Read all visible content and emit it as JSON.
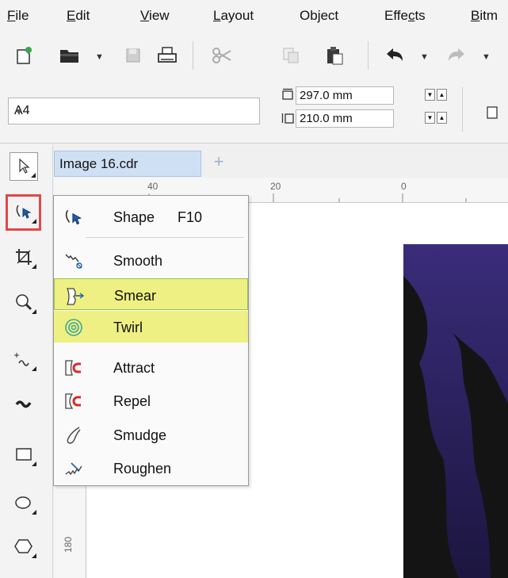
{
  "menubar": {
    "items": [
      {
        "pre": "",
        "u": "F",
        "post": "ile"
      },
      {
        "pre": "",
        "u": "E",
        "post": "dit"
      },
      {
        "pre": "",
        "u": "V",
        "post": "iew"
      },
      {
        "pre": "",
        "u": "L",
        "post": "ayout"
      },
      {
        "pre": "Ob",
        "u": "j",
        "post": "ect"
      },
      {
        "pre": "Effe",
        "u": "c",
        "post": "ts"
      },
      {
        "pre": "",
        "u": "B",
        "post": "itm"
      }
    ]
  },
  "toolbar": {
    "icons": [
      "new-document-icon",
      "open-folder-icon",
      "save-icon",
      "print-icon",
      "cut-icon",
      "copy-icon",
      "paste-icon",
      "undo-icon",
      "redo-icon"
    ]
  },
  "propbar": {
    "page_size": "A4",
    "width_value": "297.0 mm",
    "height_value": "210.0 mm"
  },
  "document": {
    "tab_title": "Image 16.cdr",
    "add_tab": "+"
  },
  "ruler": {
    "h_labels": [
      "40",
      "20",
      "0"
    ],
    "v_label": "180"
  },
  "flyout": {
    "items": [
      {
        "name": "shape",
        "label": "Shape",
        "shortcut": "F10",
        "icon": "shape-tool-icon"
      },
      {
        "name": "smooth",
        "label": "Smooth",
        "shortcut": "",
        "icon": "smooth-tool-icon"
      },
      {
        "name": "smear",
        "label": "Smear",
        "shortcut": "",
        "icon": "smear-tool-icon"
      },
      {
        "name": "twirl",
        "label": "Twirl",
        "shortcut": "",
        "icon": "twirl-tool-icon"
      },
      {
        "name": "attract",
        "label": "Attract",
        "shortcut": "",
        "icon": "attract-tool-icon"
      },
      {
        "name": "repel",
        "label": "Repel",
        "shortcut": "",
        "icon": "repel-tool-icon"
      },
      {
        "name": "smudge",
        "label": "Smudge",
        "shortcut": "",
        "icon": "smudge-tool-icon"
      },
      {
        "name": "roughen",
        "label": "Roughen",
        "shortcut": "",
        "icon": "roughen-tool-icon"
      }
    ]
  },
  "colors": {
    "highlight_fill": "#eef083",
    "highlight_border": "#92c44b",
    "selected_tool_outline": "#e04848",
    "tab_fill": "#cfe0f5",
    "artwork_dark": "#141414",
    "artwork_purple": "#3a2c7a"
  }
}
